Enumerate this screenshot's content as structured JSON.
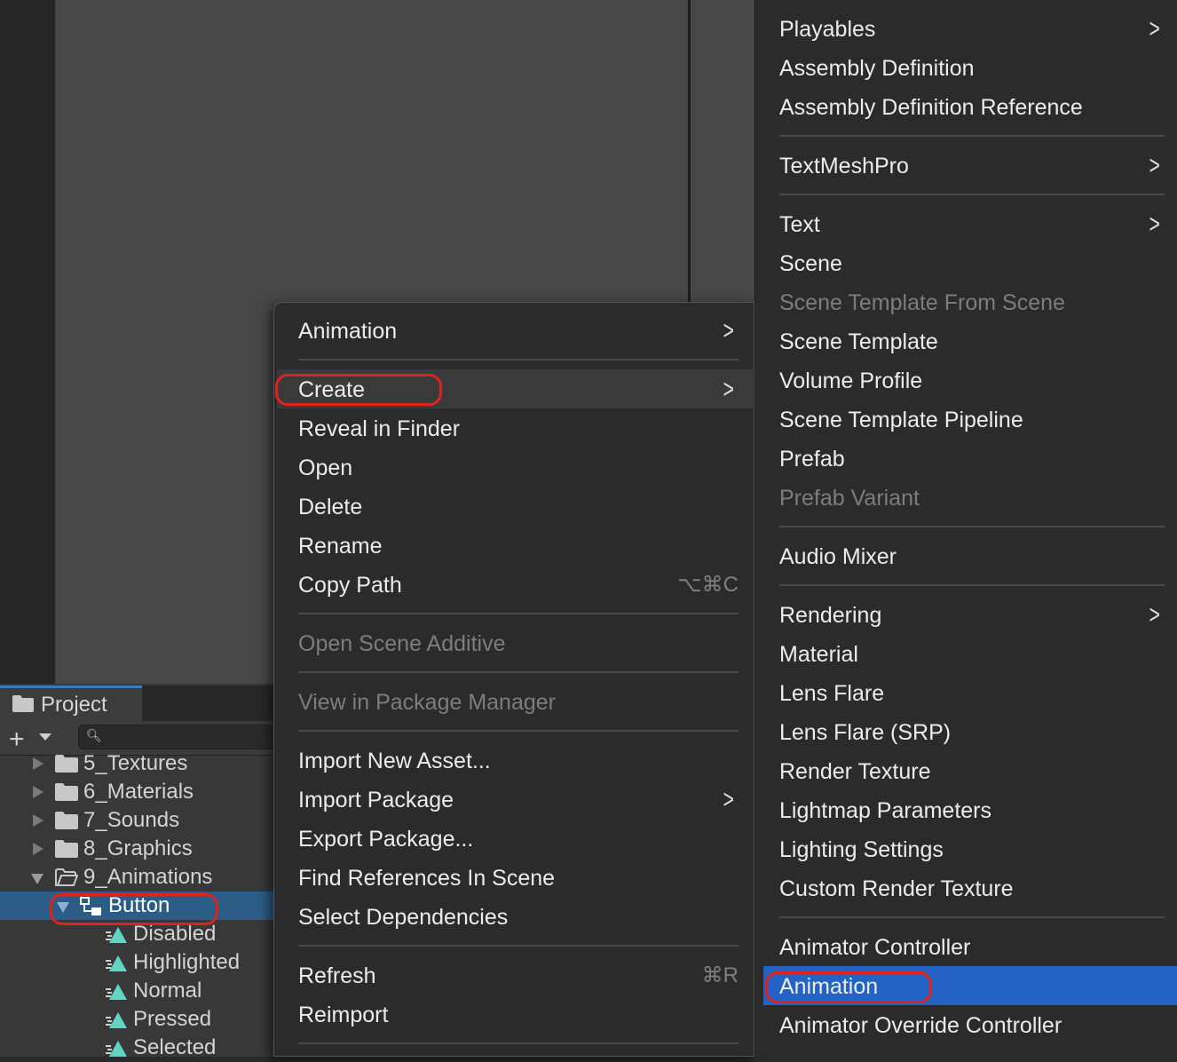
{
  "project_panel": {
    "tab_label": "Project",
    "search_placeholder": "",
    "tree": [
      {
        "label": "5_Textures",
        "type": "folder",
        "expanded": false
      },
      {
        "label": "6_Materials",
        "type": "folder",
        "expanded": false
      },
      {
        "label": "7_Sounds",
        "type": "folder",
        "expanded": false
      },
      {
        "label": "8_Graphics",
        "type": "folder",
        "expanded": false
      },
      {
        "label": "9_Animations",
        "type": "folder",
        "expanded": true
      },
      {
        "label": "Button",
        "type": "animator",
        "expanded": true,
        "selected": true
      },
      {
        "label": "Disabled",
        "type": "clip"
      },
      {
        "label": "Highlighted",
        "type": "clip"
      },
      {
        "label": "Normal",
        "type": "clip"
      },
      {
        "label": "Pressed",
        "type": "clip"
      },
      {
        "label": "Selected",
        "type": "clip"
      }
    ]
  },
  "context_menu": {
    "items": [
      {
        "label": "Animation",
        "submenu": true
      },
      {
        "label": "Create",
        "submenu": true,
        "highlighted": true
      },
      {
        "label": "Reveal in Finder"
      },
      {
        "label": "Open"
      },
      {
        "label": "Delete"
      },
      {
        "label": "Rename"
      },
      {
        "label": "Copy Path",
        "shortcut": "⌥⌘C"
      },
      {
        "label": "Open Scene Additive",
        "disabled": true
      },
      {
        "label": "View in Package Manager",
        "disabled": true
      },
      {
        "label": "Import New Asset..."
      },
      {
        "label": "Import Package",
        "submenu": true
      },
      {
        "label": "Export Package..."
      },
      {
        "label": "Find References In Scene"
      },
      {
        "label": "Select Dependencies"
      },
      {
        "label": "Refresh",
        "shortcut": "⌘R"
      },
      {
        "label": "Reimport"
      }
    ]
  },
  "create_submenu": {
    "items": [
      {
        "label": "Playables",
        "submenu": true
      },
      {
        "label": "Assembly Definition"
      },
      {
        "label": "Assembly Definition Reference"
      },
      {
        "label": "TextMeshPro",
        "submenu": true
      },
      {
        "label": "Text",
        "submenu": true
      },
      {
        "label": "Scene"
      },
      {
        "label": "Scene Template From Scene",
        "disabled": true
      },
      {
        "label": "Scene Template"
      },
      {
        "label": "Volume Profile"
      },
      {
        "label": "Scene Template Pipeline"
      },
      {
        "label": "Prefab"
      },
      {
        "label": "Prefab Variant",
        "disabled": true
      },
      {
        "label": "Audio Mixer"
      },
      {
        "label": "Rendering",
        "submenu": true
      },
      {
        "label": "Material"
      },
      {
        "label": "Lens Flare"
      },
      {
        "label": "Lens Flare (SRP)"
      },
      {
        "label": "Render Texture"
      },
      {
        "label": "Lightmap Parameters"
      },
      {
        "label": "Lighting Settings"
      },
      {
        "label": "Custom Render Texture"
      },
      {
        "label": "Animator Controller"
      },
      {
        "label": "Animation",
        "selected": true
      },
      {
        "label": "Animator Override Controller"
      }
    ]
  },
  "colors": {
    "selection_blue": "#2463c4",
    "tree_selection": "#2c5d87",
    "annotation_red": "#e0221c"
  }
}
